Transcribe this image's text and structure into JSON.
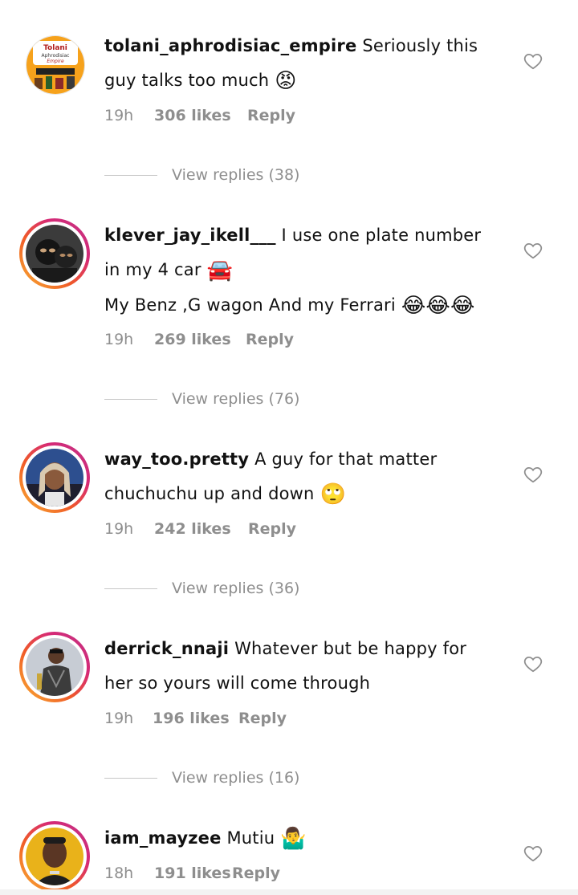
{
  "comments": [
    {
      "username": "tolani_aphrodisiac_empire",
      "text": "Seriously this guy talks too much",
      "emoji": "😡",
      "text2": "",
      "time": "19h",
      "likes": "306 likes",
      "reply": "Reply",
      "view_replies": "View replies (38)",
      "avatar_logo_lines": [
        "Tolani",
        "Aphrodisiac",
        "Empire"
      ]
    },
    {
      "username": "klever_jay_ikell___",
      "text": "I use one plate number in my 4 car",
      "emoji": "🚘",
      "text2": "My Benz ,G wagon And my Ferrari",
      "emoji2": "😂😂😂",
      "time": "19h",
      "likes": "269 likes",
      "reply": "Reply",
      "view_replies": "View replies (76)"
    },
    {
      "username": "way_too.pretty",
      "text": "A guy for that matter chuchuchu up and down",
      "emoji": "🙄",
      "time": "19h",
      "likes": "242 likes",
      "reply": "Reply",
      "view_replies": "View replies (36)"
    },
    {
      "username": "derrick_nnaji",
      "text": "Whatever but be happy for her so yours will come through",
      "emoji": "",
      "time": "19h",
      "likes": "196 likes",
      "reply": "Reply",
      "view_replies": "View replies (16)"
    },
    {
      "username": "iam_mayzee",
      "text": "Mutiu",
      "emoji": "🤷‍♂️",
      "time": "18h",
      "likes": "191 likes",
      "reply": "Reply"
    }
  ],
  "icons": {
    "like": "heart-outline-icon"
  },
  "colors": {
    "muted": "#8e8e8e",
    "ring_start": "#f9b233",
    "ring_end": "#c13584"
  }
}
